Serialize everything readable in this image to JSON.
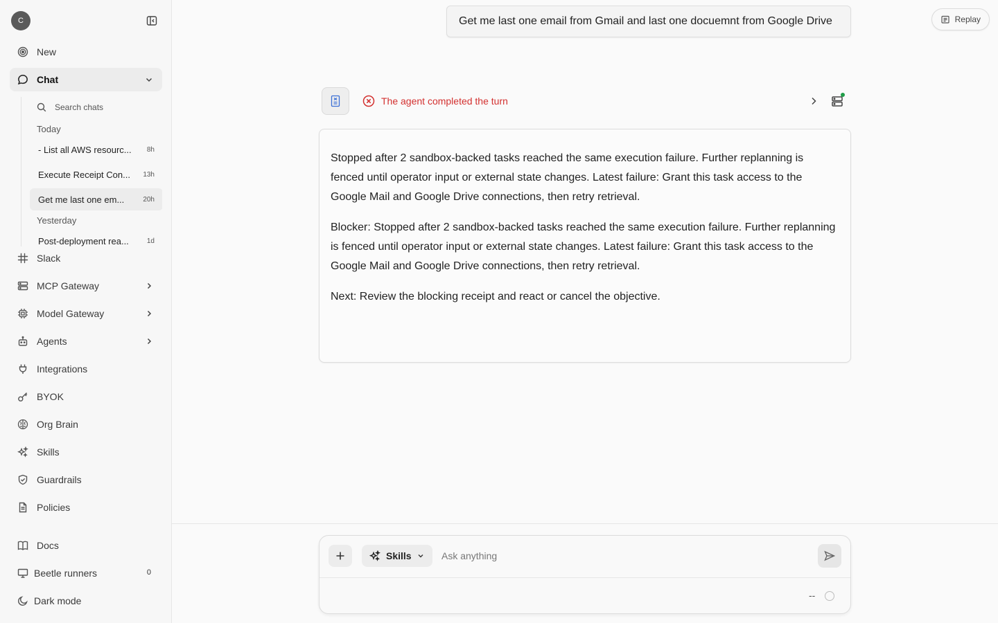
{
  "sidebar": {
    "avatar_initial": "C",
    "nav_top": [
      {
        "label": "New",
        "icon": "target-icon"
      },
      {
        "label": "Chat",
        "icon": "chat-bubble-icon"
      }
    ],
    "chat_panel": {
      "search_label": "Search chats",
      "groups": [
        {
          "label": "Today",
          "items": [
            {
              "title": "- List all AWS resourc...",
              "age": "8h"
            },
            {
              "title": "Execute Receipt Con...",
              "age": "13h"
            },
            {
              "title": "Get me last one em...",
              "age": "20h",
              "selected": true
            }
          ]
        },
        {
          "label": "Yesterday",
          "items": [
            {
              "title": "Post-deployment rea...",
              "age": "1d"
            }
          ]
        }
      ]
    },
    "nav_main": [
      {
        "label": "Slack",
        "icon": "slack-icon"
      },
      {
        "label": "MCP Gateway",
        "icon": "server-icon"
      },
      {
        "label": "Model Gateway",
        "icon": "chip-icon"
      },
      {
        "label": "Agents",
        "icon": "robot-icon"
      },
      {
        "label": "Integrations",
        "icon": "plug-icon"
      },
      {
        "label": "BYOK",
        "icon": "key-icon"
      },
      {
        "label": "Org Brain",
        "icon": "brain-icon"
      },
      {
        "label": "Skills",
        "icon": "sparkles-icon"
      },
      {
        "label": "Guardrails",
        "icon": "shield-icon"
      },
      {
        "label": "Policies",
        "icon": "document-icon"
      }
    ],
    "nav_bottom": [
      {
        "label": "Docs",
        "icon": "book-icon"
      },
      {
        "label": "Beetle runners",
        "icon": "monitor-icon",
        "count": "0"
      },
      {
        "label": "Dark mode",
        "icon": "moon-icon"
      }
    ]
  },
  "main": {
    "replay_label": "Replay",
    "user_message": "Get me last one email from Gmail and last one docuemnt from Google Drive",
    "turn_status": "The agent completed the turn",
    "result_paragraphs": [
      "Stopped after 2 sandbox-backed tasks reached the same execution failure. Further replanning is fenced until operator input or external state changes. Latest failure: Grant this task access to the Google Mail and Google Drive connections, then retry retrieval.",
      "Blocker: Stopped after 2 sandbox-backed tasks reached the same execution failure. Further replanning is fenced until operator input or external state changes. Latest failure: Grant this task access to the Google Mail and Google Drive connections, then retry retrieval.",
      "Next: Review the blocking receipt and react or cancel the objective."
    ],
    "composer": {
      "skills_label": "Skills",
      "placeholder": "Ask anything",
      "footer_text": "--"
    },
    "colors": {
      "error": "#d3302f",
      "status_dot": "#1f9d48"
    }
  }
}
